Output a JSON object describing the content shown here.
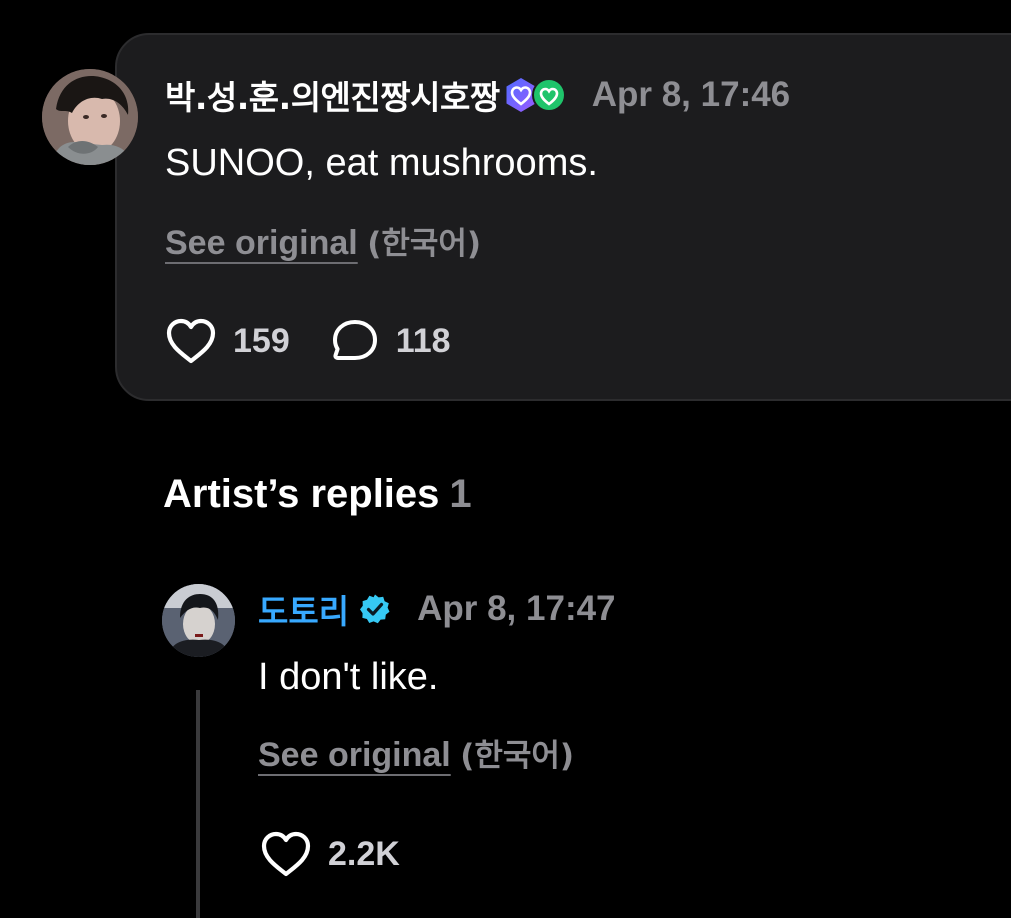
{
  "comment": {
    "username": "박.성.훈.의엔진짱시호짱",
    "badges": [
      "membership-hex-heart-icon",
      "green-heart-badge-icon"
    ],
    "timestamp": "Apr 8, 17:46",
    "text": "SUNOO, eat mushrooms.",
    "see_original_label": "See original",
    "original_language": "(한국어)",
    "likes": "159",
    "replies": "118"
  },
  "artist_replies": {
    "heading": "Artist’s replies",
    "count": "1"
  },
  "reply": {
    "artist_name": "도토리",
    "verified_icon": "verified-badge-icon",
    "timestamp": "Apr 8, 17:47",
    "text": "I don't like.",
    "see_original_label": "See original",
    "original_language": "(한국어)",
    "likes": "2.2K"
  },
  "colors": {
    "background": "#000000",
    "card": "#1c1c1e",
    "secondary_text": "#8e8e93",
    "artist_name": "#38a9ff",
    "verified": "#36c9f4"
  }
}
